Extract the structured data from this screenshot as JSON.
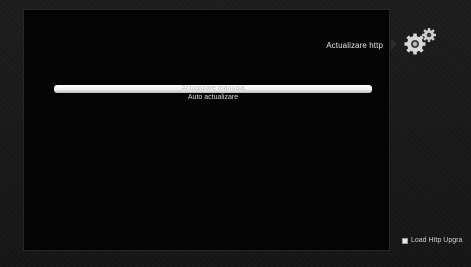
{
  "screen": {
    "title": "Actualizare http",
    "menu": {
      "items": [
        {
          "label": "Actualizare manuala",
          "selected": true
        },
        {
          "label": "Auto actualizare",
          "selected": false
        }
      ]
    },
    "sidebar": {
      "icon": "gears-icon",
      "load_option_label": "Load Http Upgra"
    }
  }
}
